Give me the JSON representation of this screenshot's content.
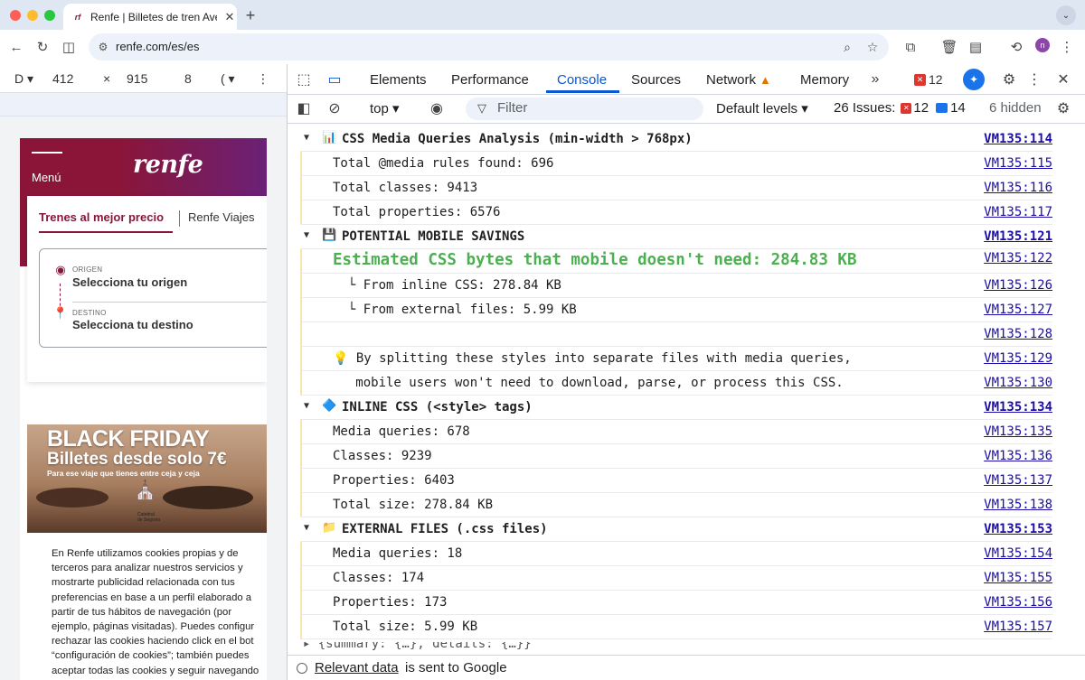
{
  "browser": {
    "tab_title": "Renfe | Billetes de tren Ave, A",
    "url": "renfe.com/es/es",
    "avatar_letter": "n"
  },
  "device_toolbar": {
    "dimensions_toggle": "D",
    "width": "412",
    "height": "915",
    "times": "×",
    "zoom_label": "8",
    "throttle_label": "("
  },
  "renfe": {
    "menu_label": "Menú",
    "logo_text": "renfe",
    "tab_active": "Trenes al mejor precio",
    "tab_inactive": "Renfe Viajes",
    "origin_small": "ORIGEN",
    "origin_big": "Selecciona tu origen",
    "dest_small": "DESTINO",
    "dest_big": "Selecciona tu destino",
    "promo_title": "BLACK FRIDAY",
    "promo_subtitle": "Billetes desde solo 7€",
    "promo_tagline": "Para ese viaje que tienes entre ceja y ceja",
    "promo_caption": "Catedral\nde Segovia",
    "cookie_text": "En Renfe utilizamos cookies propias y de\nterceros para analizar nuestros servicios y\nmostrarte publicidad relacionada con tus\npreferencias en base a un perfil elaborado a\npartir de tus hábitos de navegación (por\nejemplo, páginas visitadas). Puedes configur\nrechazar las cookies haciendo click en el bot\n“configuración de cookies”; también puedes\naceptar todas las cookies y seguir navegando"
  },
  "devtools": {
    "tabs": [
      "Elements",
      "Performance",
      "Console",
      "Sources",
      "Network",
      "Memory"
    ],
    "active_tab": "Console",
    "error_count": "12",
    "context": "top",
    "filter_placeholder": "Filter",
    "levels": "Default levels",
    "issues_label": "26 Issues:",
    "issues_errors": "12",
    "issues_messages": "14",
    "hidden": "6 hidden"
  },
  "console_rows": [
    {
      "type": "group",
      "icon": "📊",
      "text": "CSS Media Queries Analysis (min-width > 768px)",
      "src": "VM135:114"
    },
    {
      "type": "log",
      "text": "Total @media rules found: 696",
      "src": "VM135:115"
    },
    {
      "type": "log",
      "text": "Total classes: 9413",
      "src": "VM135:116"
    },
    {
      "type": "log",
      "text": "Total properties: 6576",
      "src": "VM135:117"
    },
    {
      "type": "group",
      "icon": "💾",
      "text": "POTENTIAL MOBILE SAVINGS",
      "src": "VM135:121"
    },
    {
      "type": "big",
      "text": "Estimated CSS bytes that mobile doesn't need: 284.83 KB",
      "src": "VM135:122"
    },
    {
      "type": "log",
      "text": "  └ From inline CSS: 278.84 KB",
      "src": "VM135:126"
    },
    {
      "type": "log",
      "text": "  └ From external files: 5.99 KB",
      "src": "VM135:127"
    },
    {
      "type": "log",
      "text": "",
      "src": "VM135:128"
    },
    {
      "type": "log",
      "text": "💡 By splitting these styles into separate files with media queries,",
      "src": "VM135:129"
    },
    {
      "type": "log",
      "text": "   mobile users won't need to download, parse, or process this CSS.",
      "src": "VM135:130"
    },
    {
      "type": "group",
      "icon": "🔷",
      "text": "INLINE CSS (<style> tags)",
      "src": "VM135:134"
    },
    {
      "type": "log",
      "text": "Media queries: 678",
      "src": "VM135:135"
    },
    {
      "type": "log",
      "text": "Classes: 9239",
      "src": "VM135:136"
    },
    {
      "type": "log",
      "text": "Properties: 6403",
      "src": "VM135:137"
    },
    {
      "type": "log",
      "text": "Total size: 278.84 KB",
      "src": "VM135:138"
    },
    {
      "type": "group",
      "icon": "📁",
      "text": "EXTERNAL FILES (.css files)",
      "src": "VM135:153"
    },
    {
      "type": "log",
      "text": "Media queries: 18",
      "src": "VM135:154"
    },
    {
      "type": "log",
      "text": "Classes: 174",
      "src": "VM135:155"
    },
    {
      "type": "log",
      "text": "Properties: 173",
      "src": "VM135:156"
    },
    {
      "type": "log",
      "text": "Total size: 5.99 KB",
      "src": "VM135:157"
    }
  ],
  "console_tail": "  ▸ {summary: {…}, details: {…}}",
  "footer": {
    "link": "Relevant data",
    "rest": "is sent to Google"
  }
}
